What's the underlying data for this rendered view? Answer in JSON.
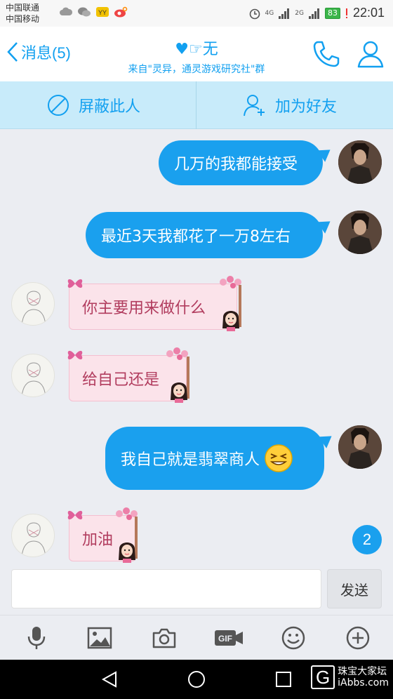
{
  "status_bar": {
    "carrier_1": "中国联通",
    "carrier_2": "中国移动",
    "signal_1": "4G",
    "signal_2": "2G",
    "battery": "83",
    "time": "22:01"
  },
  "header": {
    "back_label": "消息(5)",
    "title": "♥☞无",
    "subtitle": "来自\"灵异，通灵游戏研究社\"群",
    "icons": [
      "phone-icon",
      "profile-icon"
    ]
  },
  "actions": {
    "block_label": "屏蔽此人",
    "add_friend_label": "加为好友"
  },
  "messages": [
    {
      "from": "me",
      "text": "几万的我都能接受"
    },
    {
      "from": "me",
      "text": "最近3天我都花了一万8左右"
    },
    {
      "from": "other",
      "text": "你主要用来做什么"
    },
    {
      "from": "other",
      "text": "给自己还是"
    },
    {
      "from": "me",
      "text": "我自己就是翡翠商人"
    },
    {
      "from": "other",
      "text": "加油"
    }
  ],
  "unread_count": "2",
  "input": {
    "value": "",
    "send_label": "发送"
  },
  "toolbar_icons": [
    "microphone-icon",
    "image-icon",
    "camera-icon",
    "gif-icon",
    "emoji-icon",
    "plus-icon"
  ],
  "watermark": {
    "logo": "G",
    "line1": "珠宝大家坛",
    "line2": "iAbbs.com"
  },
  "colors": {
    "accent": "#1aa0ee",
    "action_bar": "#c8ebfa",
    "incoming_bubble": "#fbe3ea",
    "incoming_text": "#b13c5e"
  }
}
